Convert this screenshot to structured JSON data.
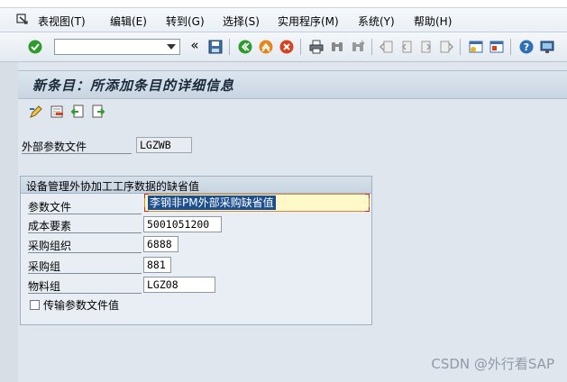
{
  "menubar": {
    "items": [
      {
        "label": "表视图(T)"
      },
      {
        "label": "编辑(E)"
      },
      {
        "label": "转到(G)"
      },
      {
        "label": "选择(S)"
      },
      {
        "label": "实用程序(M)"
      },
      {
        "label": "系统(Y)"
      },
      {
        "label": "帮助(H)"
      }
    ]
  },
  "toolbar": {
    "command_value": "",
    "icons": [
      "enter-icon",
      "command-dropdown-icon",
      "save-icon",
      "back-icon",
      "exit-icon",
      "cancel-icon",
      "print-icon",
      "find-icon",
      "find-next-icon",
      "first-page-icon",
      "previous-page-icon",
      "next-page-icon",
      "last-page-icon",
      "create-session-icon",
      "shortcut-icon",
      "help-icon",
      "layout-icon"
    ],
    "chevron": "«"
  },
  "header": {
    "title": "新条目：所添加条目的详细信息"
  },
  "app_toolbar": {
    "icons": [
      "change-display-icon",
      "delete-icon",
      "previous-entry-icon",
      "next-entry-icon"
    ]
  },
  "form": {
    "profile_label": "外部参数文件",
    "profile_value": "LGZWB",
    "group_title": "设备管理外协加工工序数据的缺省值",
    "fields": [
      {
        "label": "参数文件",
        "value": "李钢非PM外部采购缺省值"
      },
      {
        "label": "成本要素",
        "value": "5001051200"
      },
      {
        "label": "采购组织",
        "value": "6888"
      },
      {
        "label": "采购组",
        "value": "881"
      },
      {
        "label": "物料组",
        "value": "LGZ08"
      }
    ],
    "checkbox_label": "传输参数文件值",
    "checkbox_checked": false
  },
  "watermark": "CSDN @外行看SAP",
  "colors": {
    "background": "#dfe6ee",
    "header": "#c8d5e2",
    "selection": "#1d4f8f",
    "focus_border": "#cf8a3a",
    "enter_green": "#2e9a2e",
    "exit_orange": "#e08a1e",
    "cancel_red": "#d8411e"
  }
}
